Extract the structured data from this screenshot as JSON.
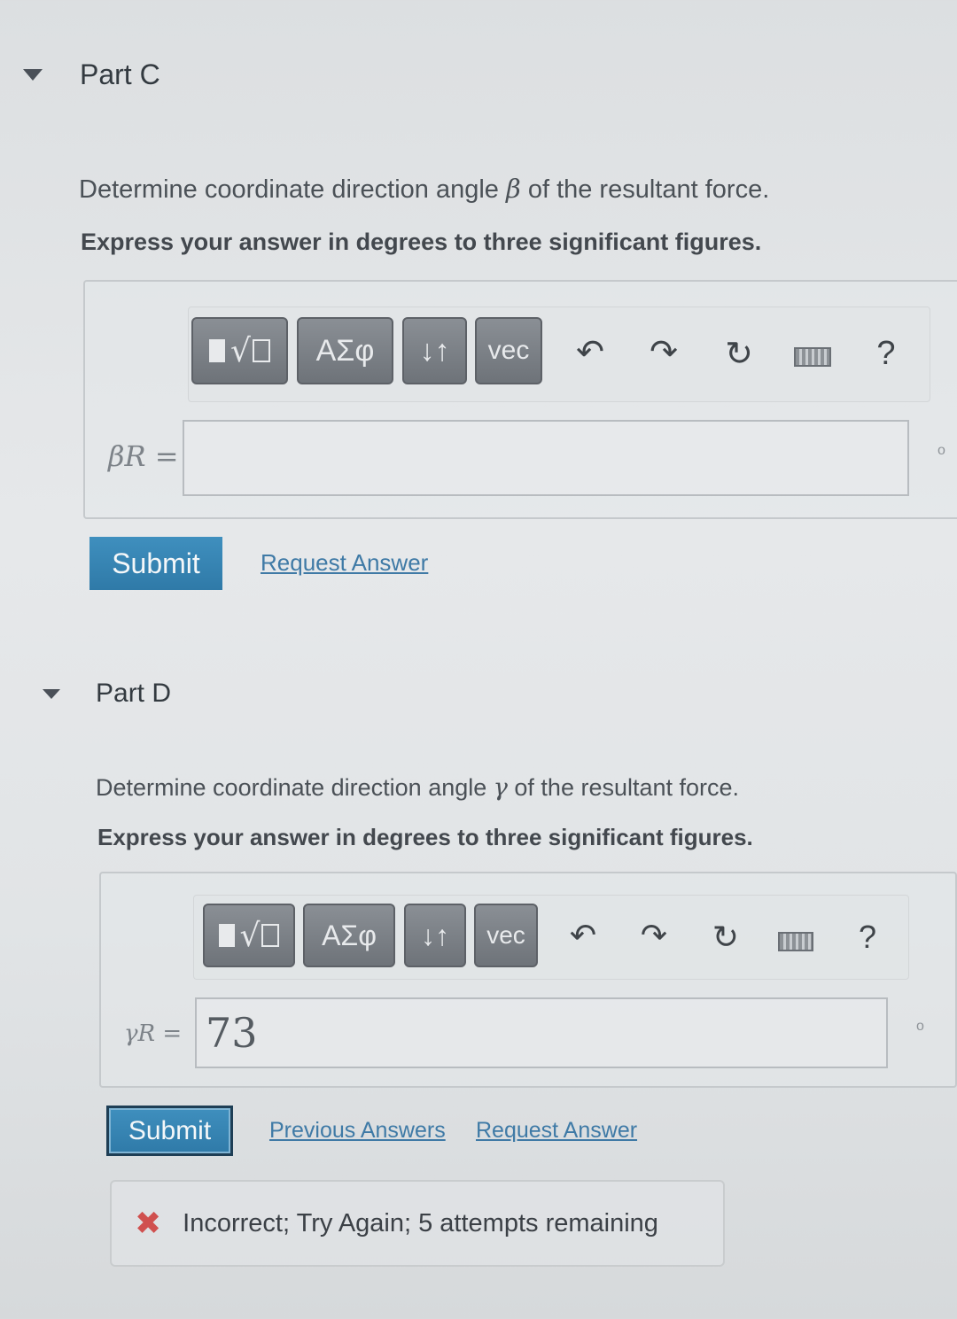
{
  "part_c": {
    "title": "Part C",
    "question_prefix": "Determine coordinate direction angle ",
    "symbol": "β",
    "question_suffix": " of the resultant force.",
    "instruction": "Express your answer in degrees to three significant figures.",
    "answer_label": "βR =",
    "answer_value": "",
    "submit_label": "Submit",
    "request_answer_label": "Request Answer"
  },
  "part_d": {
    "title": "Part D",
    "question_prefix": "Determine coordinate direction angle ",
    "symbol": "γ",
    "question_suffix": " of the resultant force.",
    "instruction": "Express your answer in degrees to three significant figures.",
    "answer_label": "γR =",
    "answer_value": "73",
    "submit_label": "Submit",
    "previous_answers_label": "Previous Answers",
    "request_answer_label": "Request Answer",
    "feedback_text": "Incorrect; Try Again; 5 attempts remaining"
  },
  "toolbar": {
    "greek_label": "ΑΣφ",
    "arrows_label": "↓↑",
    "vec_label": "vec",
    "undo_icon": "undo-icon",
    "redo_icon": "redo-icon",
    "reset_icon": "reset-icon",
    "keyboard_icon": "keyboard-icon",
    "help_label": "?"
  },
  "side_marker": "o",
  "colors": {
    "submit_blue": "#2f7aa8",
    "link_blue": "#3f7aa6",
    "error_red": "#d0504f",
    "toolbar_gray": "#6e7379"
  }
}
